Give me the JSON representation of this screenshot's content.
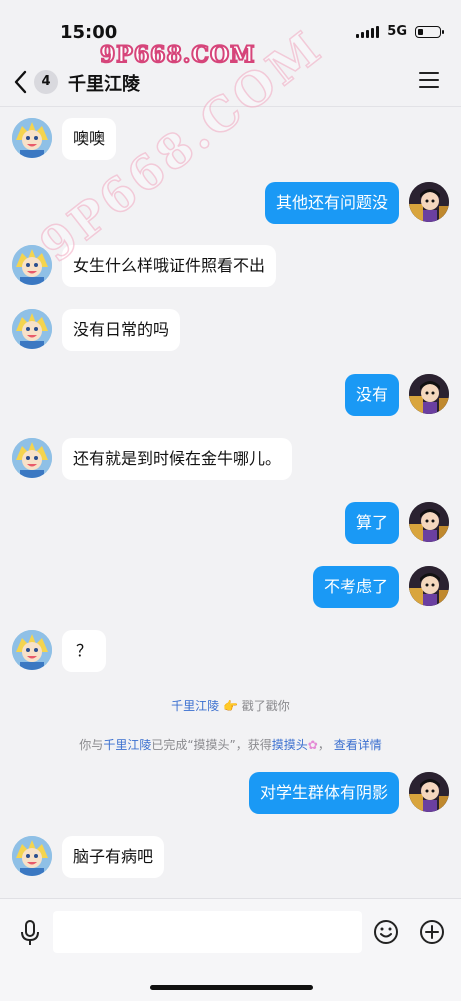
{
  "status": {
    "time": "15:00",
    "network": "5G"
  },
  "watermark": {
    "top": "9P668.COM",
    "diagonal": "9P668.COM"
  },
  "header": {
    "badge": "4",
    "title": "千里江陵"
  },
  "messages": [
    {
      "side": "left",
      "text": "噢噢"
    },
    {
      "side": "right",
      "text": "其他还有问题没"
    },
    {
      "side": "left",
      "text": "女生什么样哦证件照看不出"
    },
    {
      "side": "left",
      "text": "没有日常的吗"
    },
    {
      "side": "right",
      "text": "没有"
    },
    {
      "side": "left",
      "text": "还有就是到时候在金牛哪儿。"
    },
    {
      "side": "right",
      "text": "算了"
    },
    {
      "side": "right",
      "text": "不考虑了"
    },
    {
      "side": "left",
      "text": "？"
    },
    {
      "side": "right",
      "text": "对学生群体有阴影"
    },
    {
      "side": "left",
      "text": "脑子有病吧"
    }
  ],
  "system1": {
    "name": "千里江陵",
    "action": "戳了戳你"
  },
  "system2": {
    "prefix": "你与",
    "name": "千里江陵",
    "mid": "已完成“摸摸头”，获得",
    "reward": "摸摸头",
    "sep": "，",
    "link": "查看详情"
  },
  "input": {
    "value": "",
    "placeholder": ""
  },
  "colors": {
    "accent": "#1a99f5",
    "background": "#f2f2f4",
    "link": "#3a6fcf"
  }
}
